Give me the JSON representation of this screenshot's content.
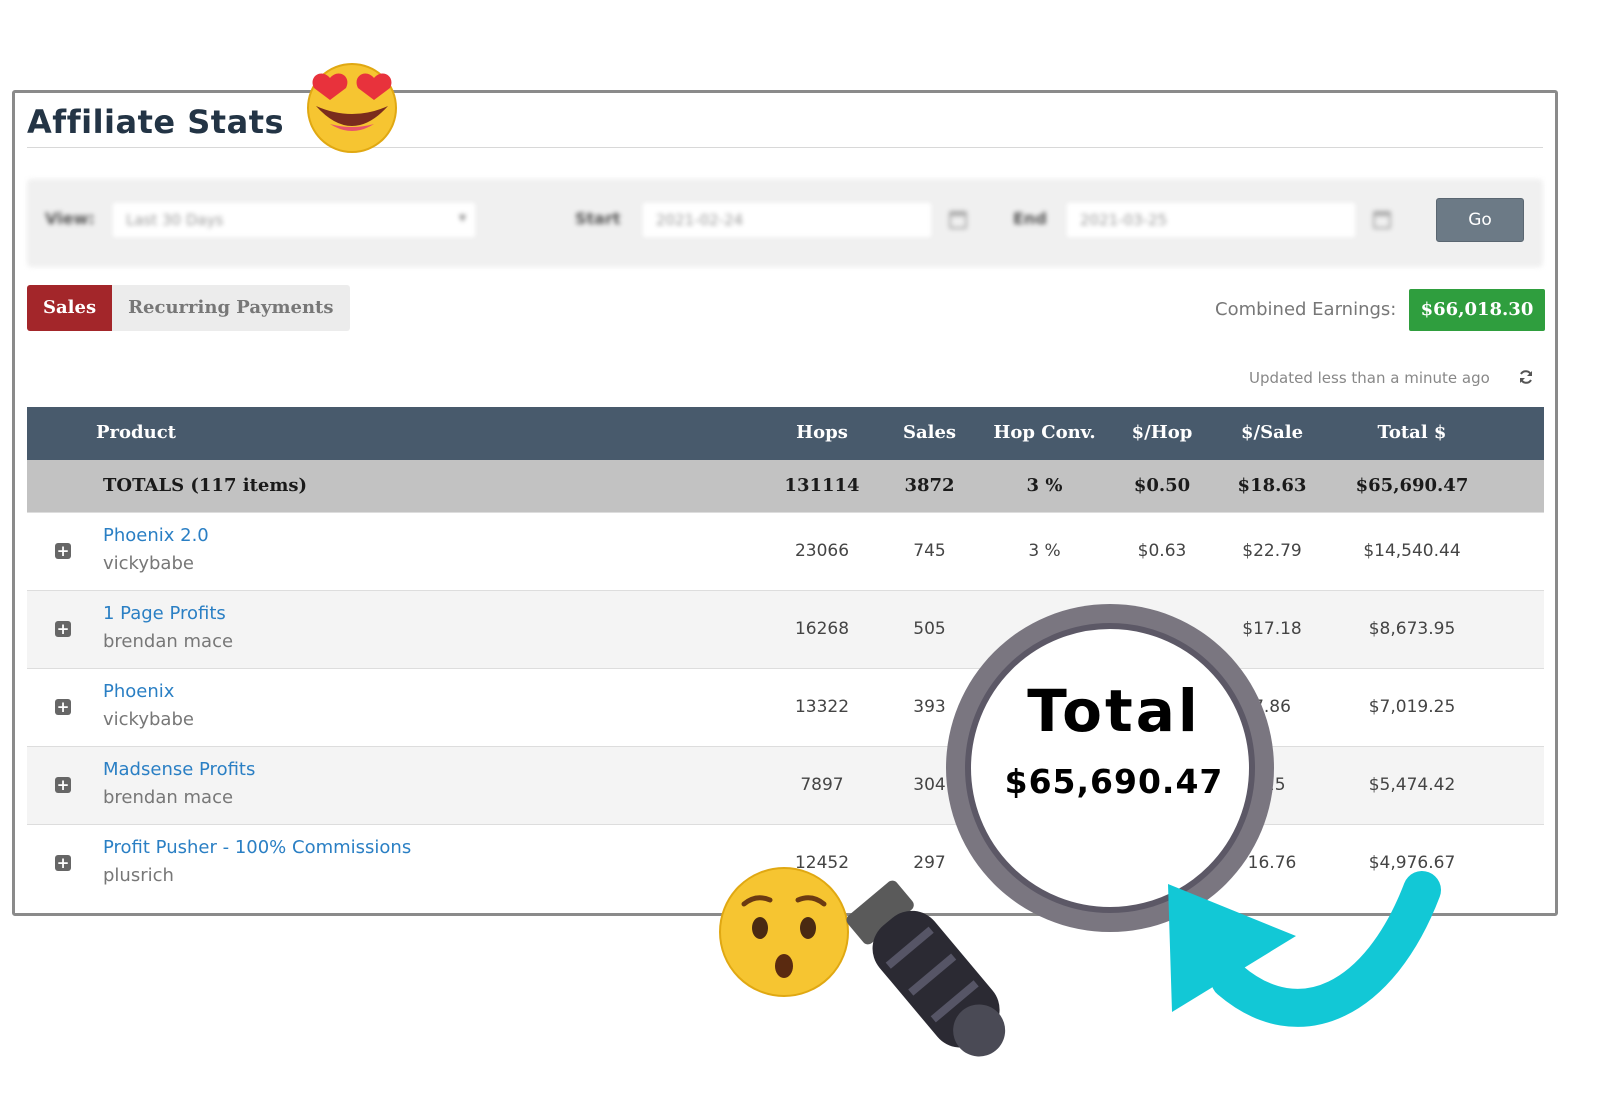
{
  "page": {
    "title": "Affiliate Stats"
  },
  "filters": {
    "view_label": "View:",
    "view_value": "Last 30 Days",
    "start_label": "Start",
    "start_value": "2021-02-24",
    "end_label": "End",
    "end_value": "2021-03-25",
    "go_label": "Go"
  },
  "tabs": [
    {
      "label": "Sales",
      "active": true
    },
    {
      "label": "Recurring Payments",
      "active": false
    }
  ],
  "earnings": {
    "label": "Combined Earnings:",
    "value": "$66,018.30"
  },
  "updated": {
    "text": "Updated less than a minute ago"
  },
  "table": {
    "headers": [
      "Product",
      "Hops",
      "Sales",
      "Hop Conv.",
      "$/Hop",
      "$/Sale",
      "Total $"
    ],
    "totals": {
      "label": "TOTALS (117 items)",
      "hops": "131114",
      "sales": "3872",
      "conv": "3 %",
      "per_hop": "$0.50",
      "per_sale": "$18.63",
      "total": "$65,690.47"
    },
    "rows": [
      {
        "name": "Phoenix 2.0",
        "vendor": "vickybabe",
        "hops": "23066",
        "sales": "745",
        "conv": "3 %",
        "per_hop": "$0.63",
        "per_sale": "$22.79",
        "total": "$14,540.44"
      },
      {
        "name": "1 Page Profits",
        "vendor": "brendan mace",
        "hops": "16268",
        "sales": "505",
        "conv": "",
        "per_hop": "",
        "per_sale": "$17.18",
        "total": "$8,673.95"
      },
      {
        "name": "Phoenix",
        "vendor": "vickybabe",
        "hops": "13322",
        "sales": "393",
        "conv": "",
        "per_hop": "",
        "per_sale": "7.86",
        "total": "$7,019.25"
      },
      {
        "name": "Madsense Profits",
        "vendor": "brendan mace",
        "hops": "7897",
        "sales": "304",
        "conv": "",
        "per_hop": "",
        "per_sale": ".25",
        "total": "$5,474.42"
      },
      {
        "name": "Profit Pusher - 100% Commissions",
        "vendor": "plusrich",
        "hops": "12452",
        "sales": "297",
        "conv": "",
        "per_hop": "",
        "per_sale": "16.76",
        "total": "$4,976.67"
      }
    ]
  },
  "magnifier": {
    "heading": "Total",
    "amount": "$65,690.47"
  },
  "icons": {
    "expand": "plus-square-icon",
    "refresh": "refresh-icon",
    "calendar": "calendar-icon",
    "emoji_top": "heart-eyes-emoji-icon",
    "emoji_bottom": "surprised-emoji-icon",
    "magnifier": "magnifying-glass-icon",
    "arrow": "curved-arrow-icon"
  },
  "colors": {
    "header_bg": "#485a6c",
    "sales_tab": "#a3262a",
    "earnings_badge": "#2f9e3e",
    "link": "#2a7fc4",
    "arrow": "#12c8d6"
  }
}
